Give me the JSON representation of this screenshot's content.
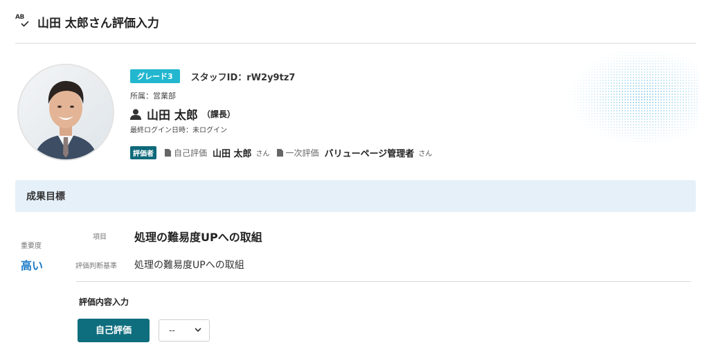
{
  "header": {
    "icon_text": "AB",
    "title": "山田 太郎さん評価入力"
  },
  "profile": {
    "grade_badge": "グレード3",
    "staff_id": "スタッフID：rW2y9tz7",
    "department": "所属：営業部",
    "name": "山田 太郎",
    "role": "（課長）",
    "last_login": "最終ログイン日時：未ログイン",
    "evaluator_badge": "評価者",
    "evaluators": [
      {
        "label": "自己評価",
        "name": "山田 太郎",
        "suffix": "さん"
      },
      {
        "label": "一次評価",
        "name": "バリューページ管理者",
        "suffix": "さん"
      }
    ]
  },
  "section": {
    "title": "成果目標"
  },
  "goal": {
    "importance_label": "重要度",
    "importance_value": "高い",
    "item_label": "項目",
    "item_value": "処理の難易度UPへの取組",
    "criteria_label": "評価判断基準",
    "criteria_value": "処理の難易度UPへの取組"
  },
  "input": {
    "label": "評価内容入力",
    "self_eval_button": "自己評価",
    "select_value": "--"
  },
  "colors": {
    "accent": "#0f6e7e",
    "grade_badge": "#22b7cf",
    "importance": "#1e7cc8",
    "section_bg": "#e6f0f8"
  }
}
